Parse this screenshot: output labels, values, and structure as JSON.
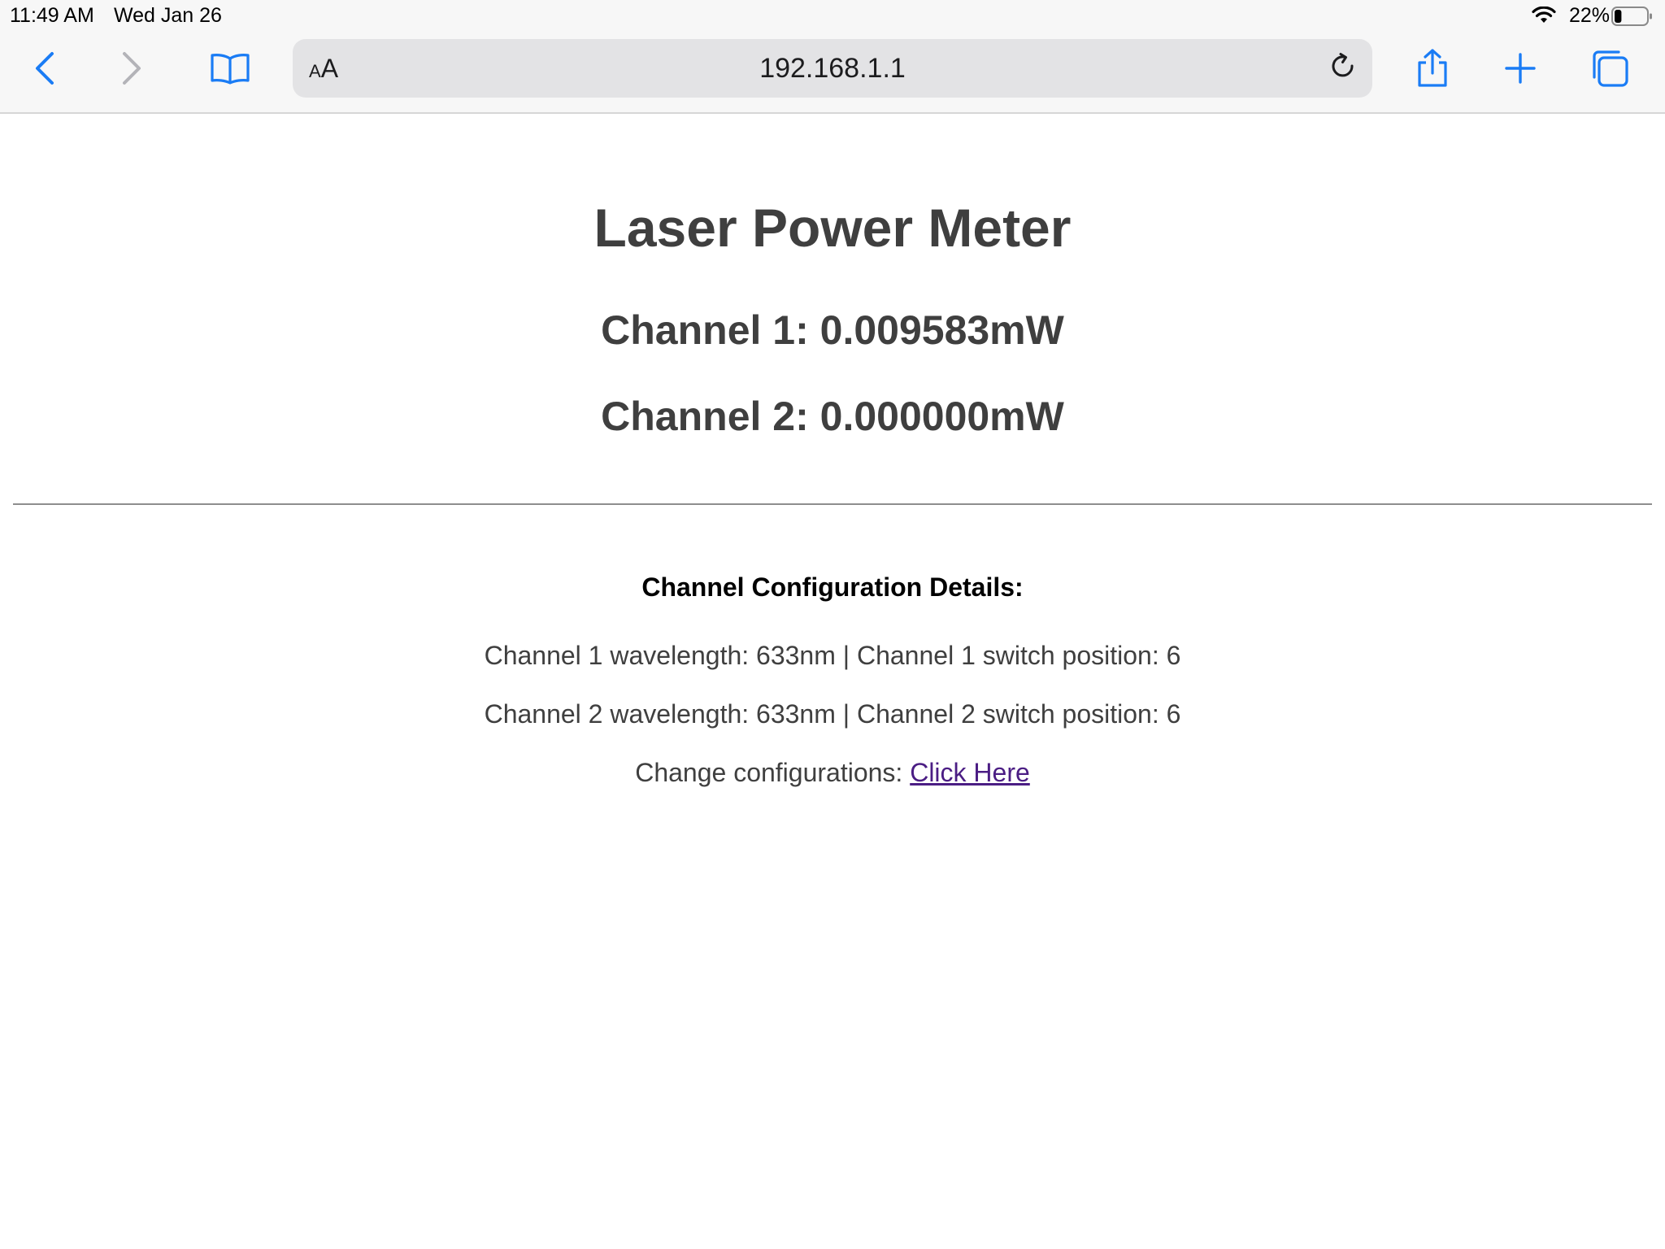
{
  "status_bar": {
    "time": "11:49 AM",
    "date": "Wed Jan 26",
    "battery_percent": "22%",
    "battery_level": 0.22
  },
  "toolbar": {
    "reader_small": "A",
    "reader_large": "A",
    "url": "192.168.1.1",
    "accent_color": "#1a7cf5",
    "disabled_color": "#b3b3b8",
    "icons": {
      "back": "chevron-left-icon",
      "forward": "chevron-right-icon",
      "bookmarks": "book-icon",
      "reload": "reload-icon",
      "share": "share-icon",
      "new_tab": "plus-icon",
      "tabs": "tabs-icon"
    }
  },
  "page": {
    "title": "Laser Power Meter",
    "channel1_reading": "Channel 1: 0.009583mW",
    "channel2_reading": "Channel 2: 0.000000mW",
    "config_heading": "Channel Configuration Details:",
    "channel1_config": "Channel 1 wavelength: 633nm | Channel 1 switch position: 6",
    "channel2_config": "Channel 2 wavelength: 633nm | Channel 2 switch position: 6",
    "change_config_label": "Change configurations: ",
    "change_config_link": "Click Here",
    "text_color": "#3f3f3f",
    "link_color": "#4b1d84"
  }
}
